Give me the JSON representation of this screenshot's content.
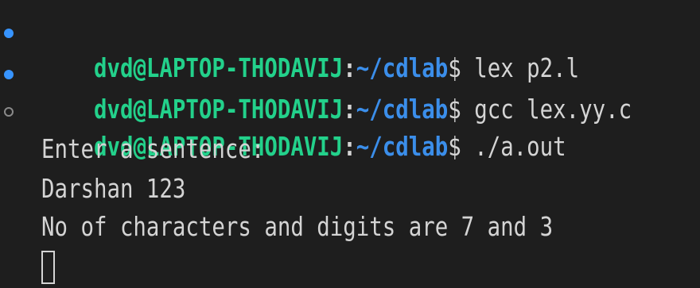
{
  "terminal": {
    "prompt": {
      "user_host": "dvd@LAPTOP-THODAVIJ",
      "separator": ":",
      "path": "~/cdlab",
      "symbol": "$"
    },
    "commands": [
      {
        "text": " lex p2.l",
        "status": "success"
      },
      {
        "text": " gcc lex.yy.c",
        "status": "success"
      },
      {
        "text": " ./a.out",
        "status": "running"
      }
    ],
    "output": [
      "Enter a sentence:",
      "Darshan 123",
      "No of characters and digits are 7 and 3"
    ],
    "colors": {
      "background": "#1e1e1e",
      "user_host": "#23d18b",
      "path": "#3b8eea",
      "text": "#d4d4d4",
      "success_decoration": "#3794ff",
      "pending_decoration": "#8a8a8a"
    }
  }
}
